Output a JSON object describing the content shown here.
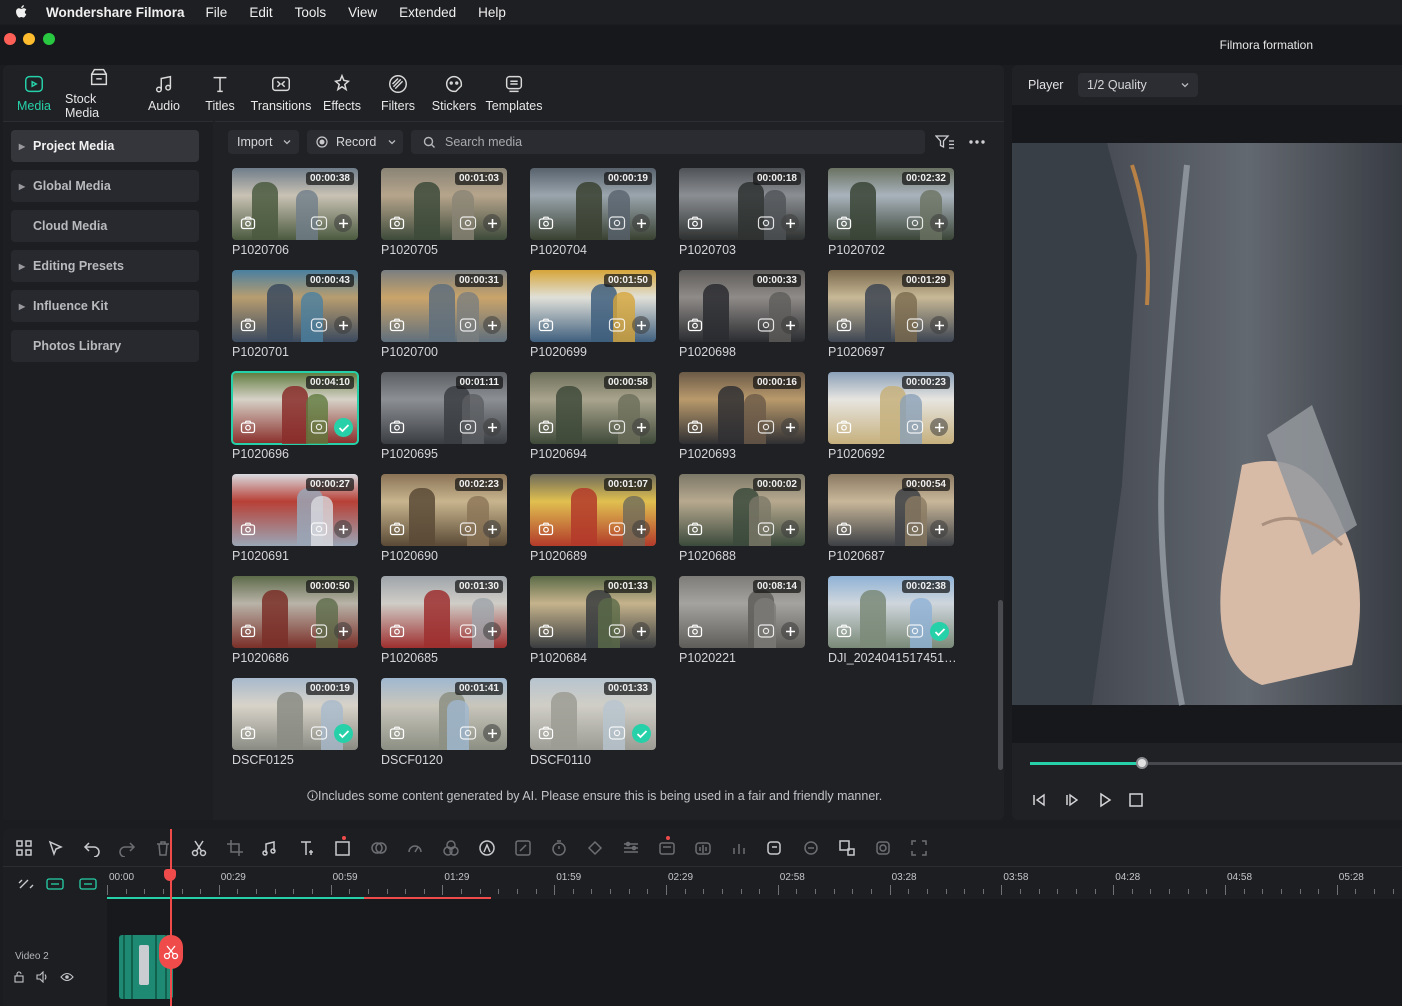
{
  "menubar": {
    "app_name": "Wondershare Filmora",
    "menus": [
      "File",
      "Edit",
      "Tools",
      "View",
      "Extended",
      "Help"
    ]
  },
  "window": {
    "title": "Filmora formation"
  },
  "toolbar": {
    "tabs": [
      {
        "label": "Media",
        "icon": "media-icon",
        "active": true
      },
      {
        "label": "Stock Media",
        "icon": "stock-media-icon"
      },
      {
        "label": "Audio",
        "icon": "music-note-icon"
      },
      {
        "label": "Titles",
        "icon": "text-t-icon"
      },
      {
        "label": "Transitions",
        "icon": "transitions-icon"
      },
      {
        "label": "Effects",
        "icon": "effects-icon"
      },
      {
        "label": "Filters",
        "icon": "filters-icon"
      },
      {
        "label": "Stickers",
        "icon": "stickers-icon"
      },
      {
        "label": "Templates",
        "icon": "templates-icon"
      }
    ]
  },
  "sidebar": {
    "items": [
      {
        "label": "Project Media",
        "expandable": true,
        "active": true
      },
      {
        "label": "Global Media",
        "expandable": true
      },
      {
        "label": "Cloud Media",
        "expandable": false
      },
      {
        "label": "Editing Presets",
        "expandable": true
      },
      {
        "label": "Influence Kit",
        "expandable": true
      },
      {
        "label": "Photos Library",
        "expandable": false
      }
    ]
  },
  "media_header": {
    "import_label": "Import",
    "record_label": "Record",
    "search_placeholder": "Search media"
  },
  "clips": [
    {
      "name": "P1020706",
      "duration": "00:00:38"
    },
    {
      "name": "P1020705",
      "duration": "00:01:03"
    },
    {
      "name": "P1020704",
      "duration": "00:00:19"
    },
    {
      "name": "P1020703",
      "duration": "00:00:18"
    },
    {
      "name": "P1020702",
      "duration": "00:02:32"
    },
    {
      "name": "P1020701",
      "duration": "00:00:43"
    },
    {
      "name": "P1020700",
      "duration": "00:00:31"
    },
    {
      "name": "P1020699",
      "duration": "00:01:50"
    },
    {
      "name": "P1020698",
      "duration": "00:00:33"
    },
    {
      "name": "P1020697",
      "duration": "00:01:29"
    },
    {
      "name": "P1020696",
      "duration": "00:04:10",
      "used": true,
      "selected": true
    },
    {
      "name": "P1020695",
      "duration": "00:01:11"
    },
    {
      "name": "P1020694",
      "duration": "00:00:58"
    },
    {
      "name": "P1020693",
      "duration": "00:00:16"
    },
    {
      "name": "P1020692",
      "duration": "00:00:23"
    },
    {
      "name": "P1020691",
      "duration": "00:00:27"
    },
    {
      "name": "P1020690",
      "duration": "00:02:23"
    },
    {
      "name": "P1020689",
      "duration": "00:01:07"
    },
    {
      "name": "P1020688",
      "duration": "00:00:02"
    },
    {
      "name": "P1020687",
      "duration": "00:00:54"
    },
    {
      "name": "P1020686",
      "duration": "00:00:50"
    },
    {
      "name": "P1020685",
      "duration": "00:01:30"
    },
    {
      "name": "P1020684",
      "duration": "00:01:33"
    },
    {
      "name": "P1020221",
      "duration": "00:08:14"
    },
    {
      "name": "DJI_2024041517451…",
      "duration": "00:02:38",
      "used": true
    },
    {
      "name": "DSCF0125",
      "duration": "00:00:19",
      "used": true
    },
    {
      "name": "DSCF0120",
      "duration": "00:01:41"
    },
    {
      "name": "DSCF0110",
      "duration": "00:01:33",
      "used": true
    }
  ],
  "notice": "Includes some content generated by AI. Please ensure this is being used in a fair and friendly manner.",
  "player": {
    "label": "Player",
    "quality": "1/2 Quality",
    "progress": 0.3
  },
  "timeline": {
    "ruler_labels": [
      "00:00",
      "00:29",
      "00:59",
      "01:29",
      "01:59",
      "02:29",
      "02:58",
      "03:28",
      "03:58",
      "04:28",
      "04:58",
      "05:28"
    ],
    "track_name": "Video 2"
  },
  "colors": {
    "accent": "#26d1a9",
    "playhead": "#f04b4b"
  }
}
